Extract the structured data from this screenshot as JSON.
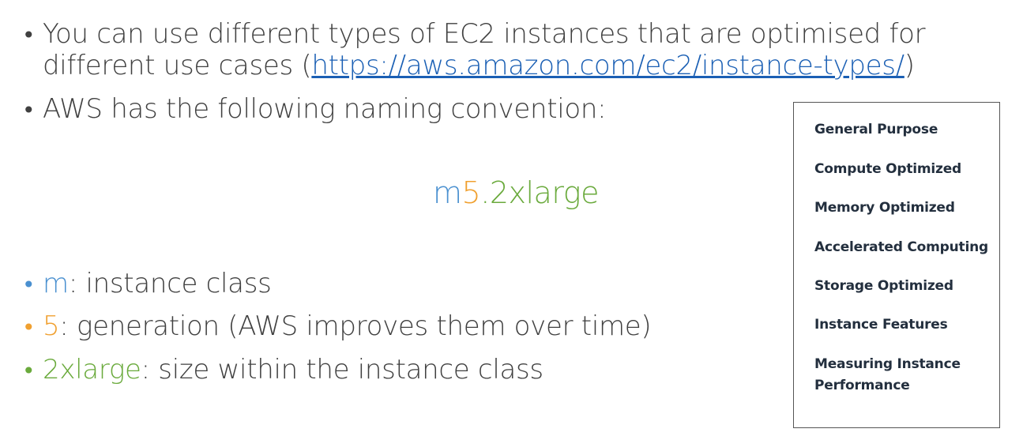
{
  "bullets": {
    "b1_line1": "You can use different types of EC2 instances that are optimised for",
    "b1_line2_prefix": "different use cases (",
    "b1_link": "https://aws.amazon.com/ec2/instance-types/",
    "b1_line2_suffix": ")",
    "b2": "AWS has the following naming convention:"
  },
  "instance_name": {
    "class": "m",
    "generation": "5",
    "dot": ".",
    "size": "2xlarge"
  },
  "explanations": [
    {
      "key": "m",
      "text": ": instance class",
      "color": "#4a90d0"
    },
    {
      "key": "5",
      "text": ": generation (AWS improves them over time)",
      "color": "#f0a030"
    },
    {
      "key": "2xlarge",
      "text": ": size within the instance class",
      "color": "#6aaa3c"
    }
  ],
  "categories_panel": {
    "items": [
      "General Purpose",
      "Compute Optimized",
      "Memory Optimized",
      "Accelerated Computing",
      "Storage Optimized",
      "Instance Features",
      "Measuring Instance Performance"
    ]
  }
}
